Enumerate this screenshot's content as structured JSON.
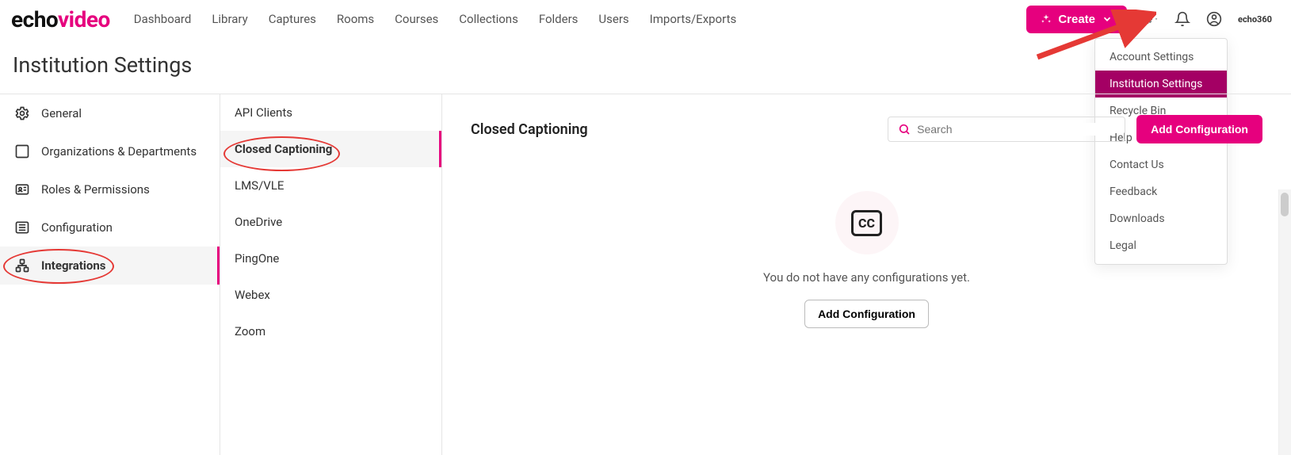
{
  "brand": {
    "part1": "echo",
    "part2": "video"
  },
  "nav": [
    "Dashboard",
    "Library",
    "Captures",
    "Rooms",
    "Courses",
    "Collections",
    "Folders",
    "Users",
    "Imports/Exports"
  ],
  "create_label": "Create",
  "top_tag": "echo360",
  "dropdown": {
    "items": [
      "Account Settings",
      "Institution Settings",
      "Recycle Bin",
      "Help",
      "Contact Us",
      "Feedback",
      "Downloads",
      "Legal"
    ],
    "selected_index": 1
  },
  "page_title": "Institution Settings",
  "sidebar1": {
    "items": [
      {
        "label": "General",
        "icon": "gear"
      },
      {
        "label": "Organizations & Departments",
        "icon": "org"
      },
      {
        "label": "Roles & Permissions",
        "icon": "id"
      },
      {
        "label": "Configuration",
        "icon": "config"
      },
      {
        "label": "Integrations",
        "icon": "integrations"
      }
    ],
    "active_index": 4
  },
  "sidebar2": {
    "items": [
      "API Clients",
      "Closed Captioning",
      "LMS/VLE",
      "OneDrive",
      "PingOne",
      "Webex",
      "Zoom"
    ],
    "active_index": 1
  },
  "content": {
    "title": "Closed Captioning",
    "search_placeholder": "Search",
    "add_button_top": "Add Configuration",
    "empty_text": "You do not have any configurations yet.",
    "add_button": "Add Configuration",
    "cc_symbol": "CC"
  }
}
